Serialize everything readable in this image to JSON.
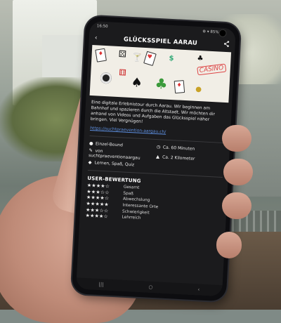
{
  "status_bar": {
    "time": "16:50",
    "indicators": "⚙ ▾ 85%"
  },
  "app_bar": {
    "back_icon": "arrow-left-icon",
    "title": "GLÜCKSSPIEL AARAU",
    "share_icon": "share-icon"
  },
  "hero": {
    "stamp_text": "CASINO",
    "icons": [
      "dice-icon",
      "card-icon",
      "cocktail-icon",
      "chip-icon",
      "spade-icon",
      "clover-icon"
    ]
  },
  "description": "Eine digitale Erlebnistour durch Aarau. Wir beginnen am Bahnhof und spazieren durch die Altstadt. Wir möchten dir anhand von Videos und Aufgaben das Glücksspiel näher bringen. Viel Vergnügen!",
  "link": "https://suchtpraevention-aargau.ch/",
  "details": {
    "mode": "Einzel-Bound",
    "author_prefix": "von",
    "author": "suchtpraeventionaargau",
    "tags": "Lernen, Spaß, Quiz",
    "duration": "Ca. 60 Minuten",
    "distance": "Ca. 2 Kilometer"
  },
  "ratings": {
    "heading": "USER-BEWERTUNG",
    "items": [
      {
        "stars": "★★★★☆",
        "label": "Gesamt"
      },
      {
        "stars": "★★★☆☆",
        "label": "Spaß"
      },
      {
        "stars": "★★★★☆",
        "label": "Abwechslung"
      },
      {
        "stars": "★★★★★",
        "label": "Interessante Orte"
      },
      {
        "stars": "★★★☆☆",
        "label": "Schwierigkeit"
      },
      {
        "stars": "★★★★☆",
        "label": "Lehrreich"
      }
    ]
  },
  "nav_bar": {
    "recents": "|||",
    "home": "○",
    "back": "‹"
  }
}
